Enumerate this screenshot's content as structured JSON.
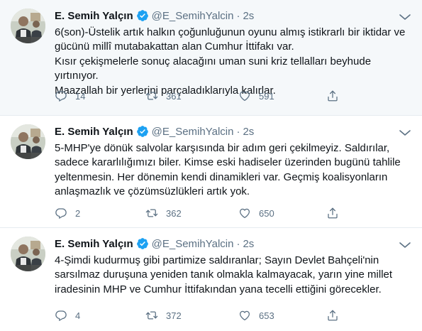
{
  "colors": {
    "text": "#0f1419",
    "secondary": "#5b7083",
    "verified": "#1da1f2",
    "divider": "#e6ecf0",
    "highlight_bg": "#f5f8fa"
  },
  "tweets": [
    {
      "name": "E. Semih Yalçın",
      "handle": "@E_SemihYalcin",
      "time": "2s",
      "lines": [
        "6(son)-Üstelik artık halkın çoğunluğunun oyunu almış istikrarlı bir iktidar ve",
        "gücünü millî mutabakattan alan Cumhur İttifakı var.",
        "Kısır çekişmelerle sonuç alacağını uman suni kriz tellalları beyhude yırtınıyor.",
        "Maazallah bir yerlerini parçaladıklarıyla kalırlar."
      ],
      "replies": "14",
      "retweets": "361",
      "likes": "591"
    },
    {
      "name": "E. Semih Yalçın",
      "handle": "@E_SemihYalcin",
      "time": "2s",
      "lines": [
        "5-MHP'ye dönük salvolar karşısında bir adım geri çekilmeyiz. Saldırılar,",
        "sadece kararlılığımızı biler. Kimse eski hadiseler üzerinden bugünü tahlile",
        "yeltenmesin. Her dönemin kendi dinamikleri var. Geçmiş koalisyonların",
        "anlaşmazlık ve çözümsüzlükleri artık yok."
      ],
      "replies": "2",
      "retweets": "362",
      "likes": "650"
    },
    {
      "name": "E. Semih Yalçın",
      "handle": "@E_SemihYalcin",
      "time": "2s",
      "lines": [
        "4-Şimdi kudurmuş gibi partimize saldıranlar; Sayın Devlet Bahçeli'nin",
        "sarsılmaz duruşuna yeniden tanık olmakla kalmayacak, yarın yine millet",
        "iradesinin MHP ve Cumhur İttifakından yana tecelli ettiğini görecekler."
      ],
      "replies": "4",
      "retweets": "372",
      "likes": "653"
    }
  ],
  "icons": {
    "verified": "verified-badge-icon",
    "more": "more-options-icon",
    "reply": "reply-icon",
    "retweet": "retweet-icon",
    "like": "heart-icon",
    "share": "share-icon"
  }
}
